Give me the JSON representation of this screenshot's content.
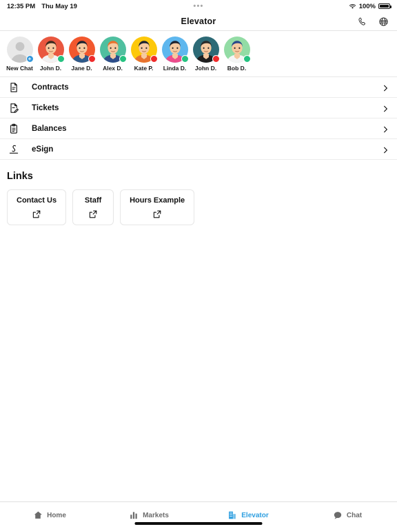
{
  "status_bar": {
    "time": "12:35 PM",
    "date": "Thu May 19",
    "center_dots": "•••",
    "battery_percent": "100%",
    "wifi_icon": "wifi-icon",
    "battery_icon": "battery-full-icon"
  },
  "header": {
    "title": "Elevator",
    "actions": [
      {
        "name": "phone-call-icon",
        "label": "Call"
      },
      {
        "name": "globe-icon",
        "label": "Web"
      }
    ]
  },
  "contacts": [
    {
      "name": "New Chat",
      "type": "new-chat",
      "badge": "plus",
      "bg": "#e5e5e5",
      "skin": "#c9c9c9",
      "hair": "#c9c9c9",
      "shirt": "#c9c9c9"
    },
    {
      "name": "John D.",
      "type": "avatar",
      "badge": "online",
      "bg": "#e9573f",
      "skin": "#f6c9a0",
      "hair": "#3d2b1f",
      "shirt": "#f2f2f2"
    },
    {
      "name": "Jane D.",
      "type": "avatar",
      "badge": "busy",
      "bg": "#f2582e",
      "skin": "#f6c9a0",
      "hair": "#1f2430",
      "shirt": "#2e5a8a"
    },
    {
      "name": "Alex D.",
      "type": "avatar",
      "badge": "online",
      "bg": "#4fbf9f",
      "skin": "#f6c9a0",
      "hair": "#e8732f",
      "shirt": "#2f4e8a"
    },
    {
      "name": "Kate P.",
      "type": "avatar",
      "badge": "busy",
      "bg": "#fdc80a",
      "skin": "#f6c9a0",
      "hair": "#1f2430",
      "shirt": "#e8732f"
    },
    {
      "name": "Linda D.",
      "type": "avatar",
      "badge": "online",
      "bg": "#5eb7ee",
      "skin": "#f6c9a0",
      "hair": "#1f2430",
      "shirt": "#ec4d8c"
    },
    {
      "name": "John D.",
      "type": "avatar",
      "badge": "busy",
      "bg": "#2d6a76",
      "skin": "#f6c9a0",
      "hair": "#2b2b2b",
      "shirt": "#1f1f1f"
    },
    {
      "name": "Bob D.",
      "type": "avatar",
      "badge": "online",
      "bg": "#93dca5",
      "skin": "#f6c9a0",
      "hair": "#2b4a8a",
      "shirt": "#f5f5f5"
    }
  ],
  "menu": [
    {
      "label": "Contracts",
      "icon": "document-icon",
      "chevron": "chevron-right-icon"
    },
    {
      "label": "Tickets",
      "icon": "document-edit-icon",
      "chevron": "chevron-right-icon"
    },
    {
      "label": "Balances",
      "icon": "clipboard-icon",
      "chevron": "chevron-right-icon"
    },
    {
      "label": "eSign",
      "icon": "signature-icon",
      "chevron": "chevron-right-icon"
    }
  ],
  "links": {
    "title": "Links",
    "items": [
      {
        "label": "Contact Us",
        "icon": "external-link-icon"
      },
      {
        "label": "Staff",
        "icon": "external-link-icon"
      },
      {
        "label": "Hours Example",
        "icon": "external-link-icon"
      }
    ]
  },
  "tab_bar": {
    "active_color": "#2e9fe0",
    "inactive_color": "#6b6b6b",
    "items": [
      {
        "label": "Home",
        "icon": "home-icon",
        "active": false
      },
      {
        "label": "Markets",
        "icon": "bar-chart-icon",
        "active": false
      },
      {
        "label": "Elevator",
        "icon": "building-icon",
        "active": true
      },
      {
        "label": "Chat",
        "icon": "chat-bubble-icon",
        "active": false
      }
    ]
  }
}
